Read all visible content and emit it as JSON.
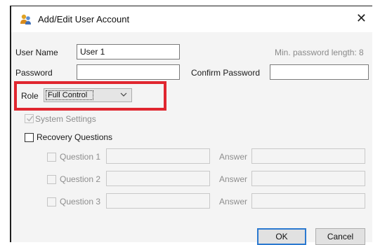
{
  "window": {
    "title": "Add/Edit User Account",
    "close_glyph": "✕",
    "app_icon": "users-icon"
  },
  "form": {
    "user_name_label": "User Name",
    "user_name_value": "User 1",
    "min_password_hint": "Min. password length: 8",
    "password_label": "Password",
    "password_value": "",
    "confirm_password_label": "Confirm Password",
    "confirm_password_value": "",
    "role_label": "Role",
    "role_value": "Full Control",
    "system_settings_label": "System Settings",
    "system_settings_checked": true,
    "recovery_questions_label": "Recovery Questions",
    "recovery_questions_checked": false,
    "questions": [
      {
        "question_label": "Question 1",
        "answer_label": "Answer"
      },
      {
        "question_label": "Question 2",
        "answer_label": "Answer"
      },
      {
        "question_label": "Question 3",
        "answer_label": "Answer"
      }
    ]
  },
  "buttons": {
    "ok_label": "OK",
    "cancel_label": "Cancel"
  },
  "colors": {
    "highlight": "#e0262f",
    "default_button_border": "#2b79d0"
  }
}
